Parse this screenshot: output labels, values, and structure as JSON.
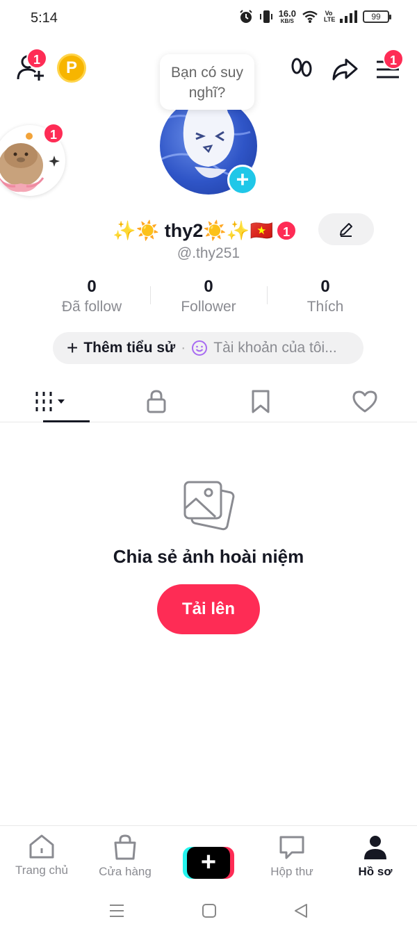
{
  "status_bar": {
    "time": "5:14",
    "net_speed_value": "16.0",
    "net_speed_unit": "KB/S",
    "volte": "Vo LTE",
    "battery": "99"
  },
  "header": {
    "add_friend_badge": "1",
    "coin_letter": "P",
    "menu_badge": "1"
  },
  "story": {
    "bubble_text": "Bạn có suy nghĩ?",
    "story_badge": "1"
  },
  "profile": {
    "display_name": "✨☀️ thy2☀️✨🇻🇳",
    "name_badge": "1",
    "handle": "@.thy251"
  },
  "stats": [
    {
      "value": "0",
      "label": "Đã follow"
    },
    {
      "value": "0",
      "label": "Follower"
    },
    {
      "value": "0",
      "label": "Thích"
    }
  ],
  "bio": {
    "add_label": "Thêm tiểu sử",
    "account_label": "Tài khoản của tôi..."
  },
  "empty_state": {
    "title": "Chia sẻ ảnh hoài niệm",
    "button": "Tải lên"
  },
  "bottom_nav": {
    "items": [
      {
        "label": "Trang chủ",
        "icon": "home-icon"
      },
      {
        "label": "Cửa hàng",
        "icon": "shop-bag-icon"
      },
      {
        "label": "",
        "icon": "create-plus-icon"
      },
      {
        "label": "Hộp thư",
        "icon": "inbox-icon"
      },
      {
        "label": "Hồ sơ",
        "icon": "profile-icon"
      }
    ]
  },
  "colors": {
    "accent": "#fe2c55",
    "plus_blue": "#20c7e8",
    "text": "#161823",
    "muted": "#8a8b91"
  }
}
